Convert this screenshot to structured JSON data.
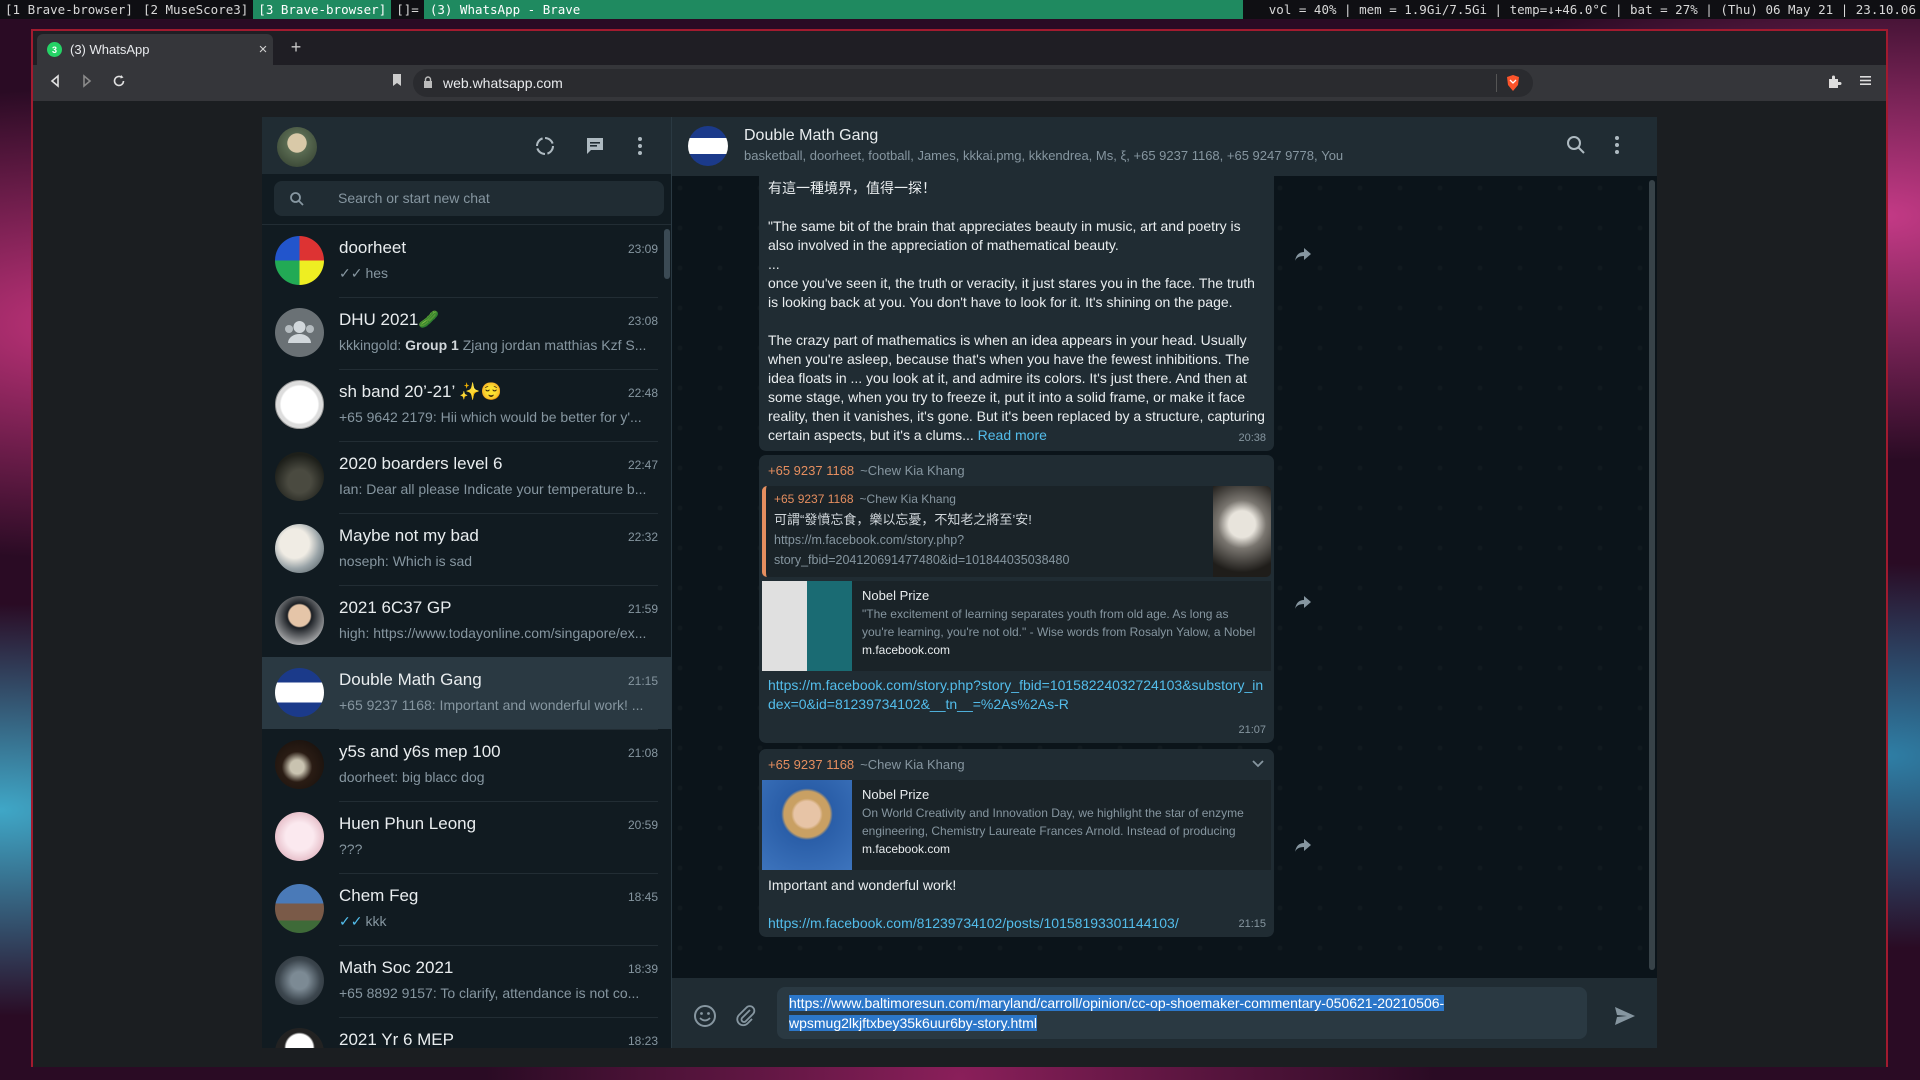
{
  "topbar": {
    "workspaces": [
      "[1 Brave-browser]",
      "[2 MuseScore3]",
      "[3 Brave-browser]",
      "[]="
    ],
    "window_title": "(3) WhatsApp - Brave",
    "status": "vol = 40% | mem = 1.9Gi/7.5Gi | temp=↓+46.0°C | bat = 27% | (Thu) 06 May 21 | 23.10.06"
  },
  "browser": {
    "tab_title": "(3) WhatsApp",
    "tab_badge": "3",
    "url": "web.whatsapp.com",
    "new_tab": "+",
    "close": "×"
  },
  "sidebar": {
    "search_placeholder": "Search or start new chat",
    "chats": [
      {
        "name": "doorheet",
        "time": "23:09",
        "tick": "grey",
        "preview": "hes"
      },
      {
        "name": "DHU 2021🥒",
        "time": "23:08",
        "preview_sender": "kkkingold: ",
        "preview_bold": "Group 1",
        "preview": " Zjang jordan matthias Kzf S..."
      },
      {
        "name": "sh band 20’-21’ ✨😌",
        "time": "22:48",
        "preview": "+65 9642 2179: Hii which would be better for y'..."
      },
      {
        "name": "2020 boarders level 6",
        "time": "22:47",
        "preview": "Ian: Dear all please Indicate your temperature b..."
      },
      {
        "name": "Maybe not my bad",
        "time": "22:32",
        "preview": "noseph: Which is sad"
      },
      {
        "name": "2021 6C37 GP",
        "time": "21:59",
        "preview": "high: https://www.todayonline.com/singapore/ex..."
      },
      {
        "name": "Double Math Gang",
        "time": "21:15",
        "preview": "+65 9237 1168: Important and wonderful work! ..."
      },
      {
        "name": "y5s and y6s mep 100",
        "time": "21:08",
        "preview": "doorheet: big blacc dog"
      },
      {
        "name": "Huen Phun Leong",
        "time": "20:59",
        "preview": "???"
      },
      {
        "name": "Chem Feg",
        "time": "18:45",
        "tick": "blue",
        "preview": "kkk"
      },
      {
        "name": "Math Soc 2021",
        "time": "18:39",
        "preview": "+65 8892 9157: To clarify, attendance is not co..."
      },
      {
        "name": "2021 Yr 6 MEP",
        "time": "18:23",
        "preview": ""
      }
    ]
  },
  "conversation": {
    "title": "Double Math Gang",
    "participants": "basketball, doorheet, football, James, kkkai.pmg, kkkendrea, Ms, ξ, +65 9237 1168, +65 9247 9778, You",
    "msg1": {
      "line_zh": "有這一種境界，值得一探！",
      "quote1": "\"The same bit of the brain that appreciates beauty in music, art and poetry is also involved in the appreciation of mathematical beauty.",
      "ellipsis": "...",
      "quote2": "once you've seen it, the truth or veracity, it just stares you in the face. The truth is looking back at you. You don't have to look for it. It's shining on the page.",
      "quote3": "The crazy part of mathematics is when an idea appears in your head. Usually when you're asleep, because that's when you have the fewest inhibitions. The idea floats in ...  you look at it, and admire its colors. It's just there. And then at some stage, when you try to freeze it, put it into a solid frame, or make it face reality, then it vanishes, it's gone. But it's been replaced by a structure, capturing certain aspects, but it's a clums...",
      "read_more": "Read more",
      "time": "20:38"
    },
    "msg2": {
      "sender": "+65 9237 1168",
      "sender_name": "~Chew Kia Khang",
      "reply_sender": "+65 9237 1168",
      "reply_name": "~Chew Kia Khang",
      "reply_text_zh": "可謂“發憤忘食，樂以忘憂，不知老之將至’安!",
      "reply_link1": "https://m.facebook.com/story.php?",
      "reply_link2": "story_fbid=204120691477480&id=101844035038480",
      "preview_title": "Nobel Prize",
      "preview_desc": "\"The excitement of learning separates youth from old age. As long as you're learning, you're not old.\" - Wise words from Rosalyn Yalow, a Nobel",
      "preview_domain": "m.facebook.com",
      "link": "https://m.facebook.com/story.php?story_fbid=10158224032724103&substory_index=0&id=81239734102&__tn__=%2As%2As-R",
      "time": "21:07"
    },
    "msg3": {
      "sender": "+65 9237 1168",
      "sender_name": "~Chew Kia Khang",
      "preview_title": "Nobel Prize",
      "preview_desc": "On World Creativity and Innovation Day, we highlight the star of enzyme engineering, Chemistry Laureate Frances Arnold. Instead of producing",
      "preview_domain": "m.facebook.com",
      "text": "Important and wonderful work!",
      "link": "https://m.facebook.com/81239734102/posts/10158193301144103/",
      "time": "21:15"
    },
    "compose_text": "https://www.baltimoresun.com/maryland/carroll/opinion/cc-op-shoemaker-commentary-050621-20210506-wpsmug2lkjftxbey35k6uur6by-story.html"
  },
  "colors": {
    "accent": "#00a884",
    "panel": "#202c33",
    "bg": "#111b21",
    "link": "#53bdeb"
  }
}
